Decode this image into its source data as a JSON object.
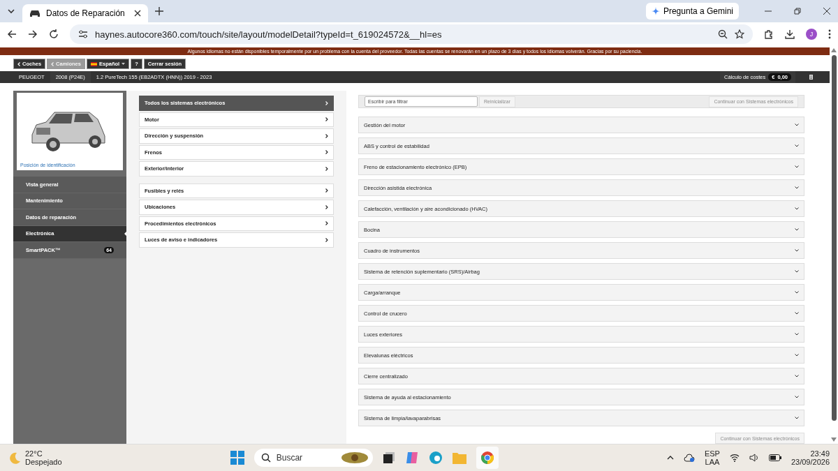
{
  "browser": {
    "tab_title": "Datos de Reparación",
    "gemini": "Pregunta a Gemini",
    "url": "haynes.autocore360.com/touch/site/layout/modelDetail?typeId=t_619024572&__hl=es",
    "profile": "J"
  },
  "notice": "Algunos idiomas no están disponibles temporalmente por un problema con la cuenta del proveedor. Todas las cuentas se renovarán en un plazo de 3 días y todos los idiomas volverán. Gracias por su paciencia.",
  "nav_buttons": [
    {
      "label": "Coches",
      "kind": "back",
      "disabled": false
    },
    {
      "label": "Camiones",
      "kind": "back",
      "disabled": true
    },
    {
      "label": "Español",
      "kind": "language",
      "disabled": false
    },
    {
      "label": "?",
      "kind": "plain",
      "disabled": false
    },
    {
      "label": "Cerrar sesión",
      "kind": "plain",
      "disabled": false
    }
  ],
  "vehicle": [
    "PEUGEOT",
    "2008 (P24E)",
    "1.2 PureTech 155 (EB2ADTX (HNN)) 2019 - 2023"
  ],
  "cost": {
    "label": "Cálculo de costes",
    "currency": "€",
    "value": "0,00"
  },
  "sidebar": {
    "id_link": "Posición de identificación",
    "items": [
      {
        "label": "Vista general",
        "selected": false
      },
      {
        "label": "Mantenimiento",
        "selected": false
      },
      {
        "label": "Datos de reparación",
        "selected": false
      },
      {
        "label": "Electrónica",
        "selected": true
      },
      {
        "label": "SmartPACK™",
        "selected": false,
        "badge": "64"
      }
    ]
  },
  "menu_groups": [
    [
      {
        "label": "Todos los sistemas electrónicos",
        "selected": true
      },
      {
        "label": "Motor",
        "selected": false
      },
      {
        "label": "Dirección y suspensión",
        "selected": false
      },
      {
        "label": "Frenos",
        "selected": false
      },
      {
        "label": "Exterior/interior",
        "selected": false
      }
    ],
    [
      {
        "label": "Fusibles y relés",
        "selected": false
      },
      {
        "label": "Ubicaciones",
        "selected": false
      },
      {
        "label": "Procedimientos electrónicos",
        "selected": false
      },
      {
        "label": "Luces de aviso e indicadores",
        "selected": false
      }
    ]
  ],
  "filter": {
    "placeholder": "Escribir para filtrar",
    "reset": {
      "label": "Reinicializar",
      "disabled": true
    },
    "continue": {
      "label": "Continuar con Sistemas electrónicos",
      "disabled": true
    }
  },
  "systems": [
    "Gestión del motor",
    "ABS y control de estabilidad",
    "Freno de estacionamiento electrónico (EPB)",
    "Dirección asistida electrónica",
    "Calefacción, ventilación y aire acondicionado (HVAC)",
    "Bocina",
    "Cuadro de instrumentos",
    "Sistema de retención suplementario (SRS)/Airbag",
    "Carga/arranque",
    "Control de crucero",
    "Luces exteriores",
    "Elevalunas eléctricos",
    "Cierre centralizado",
    "Sistema de ayuda al estacionamiento",
    "Sistema de limpia/lavaparabrisas"
  ],
  "bottom_continue": {
    "label": "Continuar con Sistemas electrónicos",
    "disabled": true
  },
  "taskbar": {
    "temperature": "22°C",
    "weather": "Despejado",
    "search_placeholder": "Buscar",
    "lang_1": "ESP",
    "lang_2": "LAA",
    "time": "23:49",
    "date": "23/09/2026"
  }
}
